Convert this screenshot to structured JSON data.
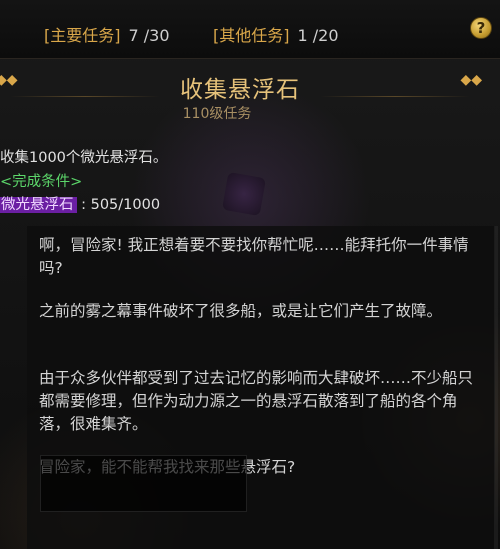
{
  "tabs": {
    "main_label": "[主要任务]",
    "main_count": "7 /30",
    "other_label": "[其他任务]",
    "other_count": "1 /20"
  },
  "help_button": "?",
  "quest": {
    "title": "收集悬浮石",
    "level": "110级任务",
    "objective": "收集1000个微光悬浮石。",
    "condition_label": "<完成条件>",
    "item_name": "微光悬浮石",
    "progress": " : 505/1000"
  },
  "dialogue": [
    "啊，冒险家! 我正想着要不要找你帮忙呢……能拜托你一件事情吗?",
    "之前的雾之幕事件破坏了很多船，或是让它们产生了故障。",
    "由于众多伙伴都受到了过去记忆的影响而大肆破坏……不少船只都需要修理，但作为动力源之一的悬浮石散落到了船的各个角落，很难集齐。",
    "冒险家，能不能帮我找来那些悬浮石?"
  ],
  "icons": {
    "left_chevron": "double-chevron-left-icon",
    "right_chevron": "double-chevron-right-icon",
    "help": "help-icon"
  },
  "colors": {
    "gold": "#d9a74a",
    "title": "#e6c27a",
    "condition_green": "#5cd66a",
    "item_purple": "#6b1fa3"
  }
}
